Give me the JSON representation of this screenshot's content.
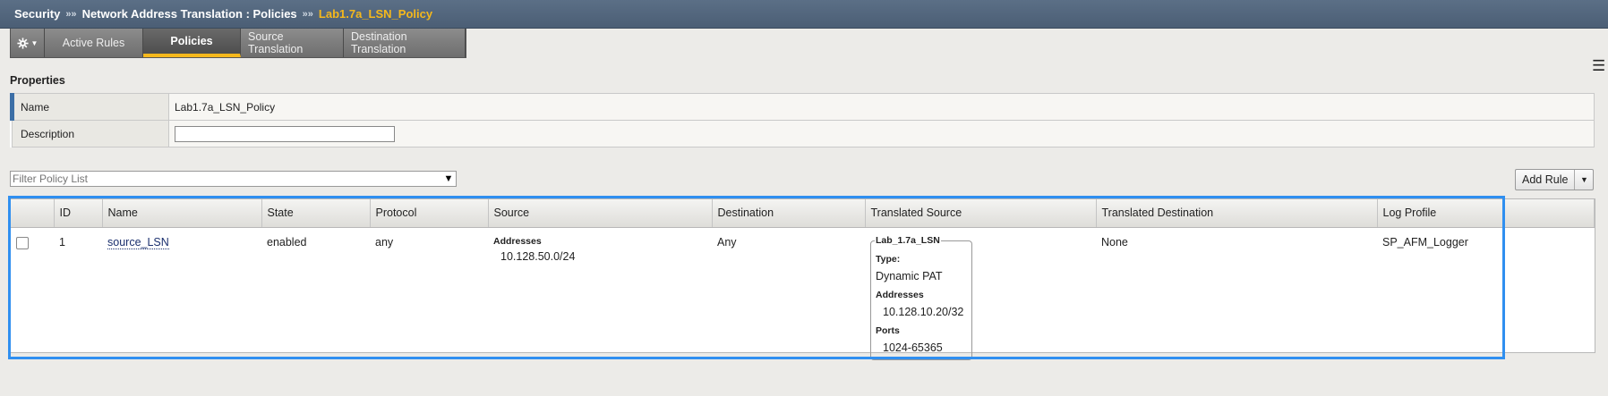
{
  "breadcrumb": {
    "items": [
      "Security",
      "Network Address Translation : Policies"
    ],
    "current": "Lab1.7a_LSN_Policy",
    "separator": "»»"
  },
  "tabs": [
    {
      "label": "Active Rules"
    },
    {
      "label": "Policies"
    },
    {
      "label": "Source Translation"
    },
    {
      "label": "Destination Translation"
    }
  ],
  "properties": {
    "title": "Properties",
    "name_label": "Name",
    "name_value": "Lab1.7a_LSN_Policy",
    "description_label": "Description",
    "description_value": ""
  },
  "filter": {
    "placeholder": "Filter Policy List"
  },
  "add_rule": {
    "label": "Add Rule"
  },
  "rules_table": {
    "headers": [
      "ID",
      "Name",
      "State",
      "Protocol",
      "Source",
      "Destination",
      "Translated Source",
      "Translated Destination",
      "Log Profile"
    ],
    "rows": [
      {
        "id": "1",
        "name": "source_LSN",
        "state": "enabled",
        "protocol": "any",
        "source_header": "Addresses",
        "source_value": "10.128.50.0/24",
        "destination": "Any",
        "translated_source": {
          "name": "Lab_1.7a_LSN",
          "type_label": "Type:",
          "type_value": "Dynamic PAT",
          "addresses_label": "Addresses",
          "addresses_value": "10.128.10.20/32",
          "ports_label": "Ports",
          "ports_value": "1024-65365"
        },
        "translated_destination": "None",
        "log_profile": "SP_AFM_Logger"
      }
    ]
  },
  "colors": {
    "accent": "#f5b81c",
    "header_bg": "#4b5e75",
    "highlight": "#2f8ff0"
  }
}
